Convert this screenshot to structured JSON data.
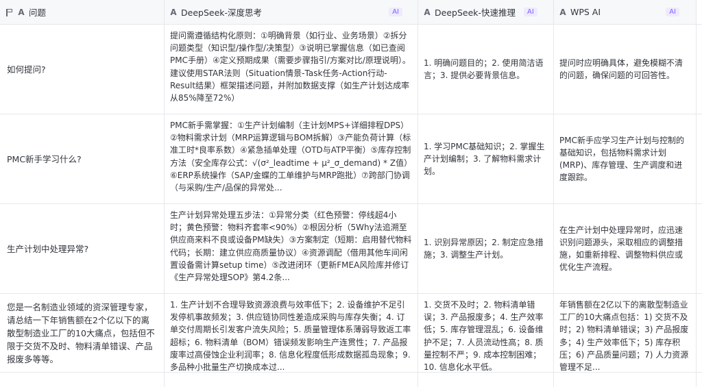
{
  "headers": [
    {
      "label": "问题",
      "ai": ""
    },
    {
      "label": "DeepSeek-深度思考",
      "ai": "AI"
    },
    {
      "label": "DeepSeek-快速推理",
      "ai": "AI"
    },
    {
      "label": "WPS AI",
      "ai": "AI"
    }
  ],
  "rows": [
    {
      "question": "如何提问?",
      "deep": "提问需遵循结构化原则：①明确背景（如行业、业务场景）②拆分问题类型（知识型/操作型/决策型）③说明已掌握信息（如已查阅PMC手册）④定义预期成果（需要步骤指引/方案对比/原理说明）。建议使用STAR法则（Situation情景-Task任务-Action行动-Result结果）框架描述问题，并附加数据支撑（如生产计划达成率从85%降至72%）",
      "fast": "1. 明确问题目的；2. 使用简洁语言；3. 提供必要背景信息。",
      "wps": "提问时应明确具体，避免模糊不清的问题，确保问题的可回答性。"
    },
    {
      "question": "PMC新手学习什么?",
      "deep": "PMC新手需掌握：①生产计划编制（主计划MPS+详细排程DPS）②物料需求计划（MRP运算逻辑与BOM拆解）③产能负荷计算（标准工时*良率系数）④紧急插单处理（OTD与ATP平衡）⑤库存控制方法（安全库存公式：√(σ²_leadtime + μ²_σ_demand) * Z值）⑥ERP系统操作（SAP/金蝶的工单维护与MRP跑批）⑦跨部门协调（与采购/生产/品保的异常处...",
      "fast": "1. 学习PMC基础知识；2. 掌握生产计划编制；3. 了解物料需求计划。",
      "wps": "PMC新手应学习生产计划与控制的基础知识，包括物料需求计划(MRP)、库存管理、生产调度和进度跟踪。"
    },
    {
      "question": "生产计划中处理异常?",
      "deep": "生产计划异常处理五步法：①异常分类（红色预警：停线超4小时；黄色预警：物料齐套率<90%）②根因分析（5Why法追溯至供应商来料不良或设备PM缺失）③方案制定（短期：启用替代物料代码；长期：建立供应商质量协议）④资源调配（借用其他车间闲置设备需计算setup time）⑤改进闭环（更新FMEA风险库并修订《生产异常处理SOP》第4.2条...",
      "fast": "1. 识别异常原因；2. 制定应急措施；3. 调整生产计划。",
      "wps": "在生产计划中处理异常时，应迅速识别问题源头，采取相应的调整措施，如重新排程、调整物料供应或优化生产流程。"
    },
    {
      "question": "您是一名制造业领域的资深管理专家，请总结一下年销售额在2个亿以下的离散型制造业工厂的10大痛点，包括但不限于交货不及时、物料清单错误、产品报废多等等。",
      "deep": "1. 生产计划不合理导致资源浪费与效率低下；2. 设备维护不足引发停机事故频发；3. 供应链协同性差造成采购与库存失衡；4. 订单交付周期长引发客户流失风险；5. 质量管理体系薄弱导致返工率超标；6. 物料清单（BOM）错误频发影响生产连贯性；7. 产品报废率过高侵蚀企业利润率；8. 信息化程度低形成数据孤岛现象；9. 多品种小批量生产切换成本过...",
      "fast": "1. 交货不及时；2. 物料清单错误；3. 产品报废多；4. 生产效率低；5. 库存管理混乱；6. 设备维护不足；7. 人员流动性高；8. 质量控制不严；9. 成本控制困难；10. 信息化水平低。",
      "wps": "年销售额在2亿以下的离散型制造业工厂的10大痛点包括：1) 交货不及时；2) 物料清单错误；3) 产品报废多；4) 生产效率低下；5) 库存积压；6) 产品质量问题；7) 人力资源管理不足..."
    }
  ]
}
